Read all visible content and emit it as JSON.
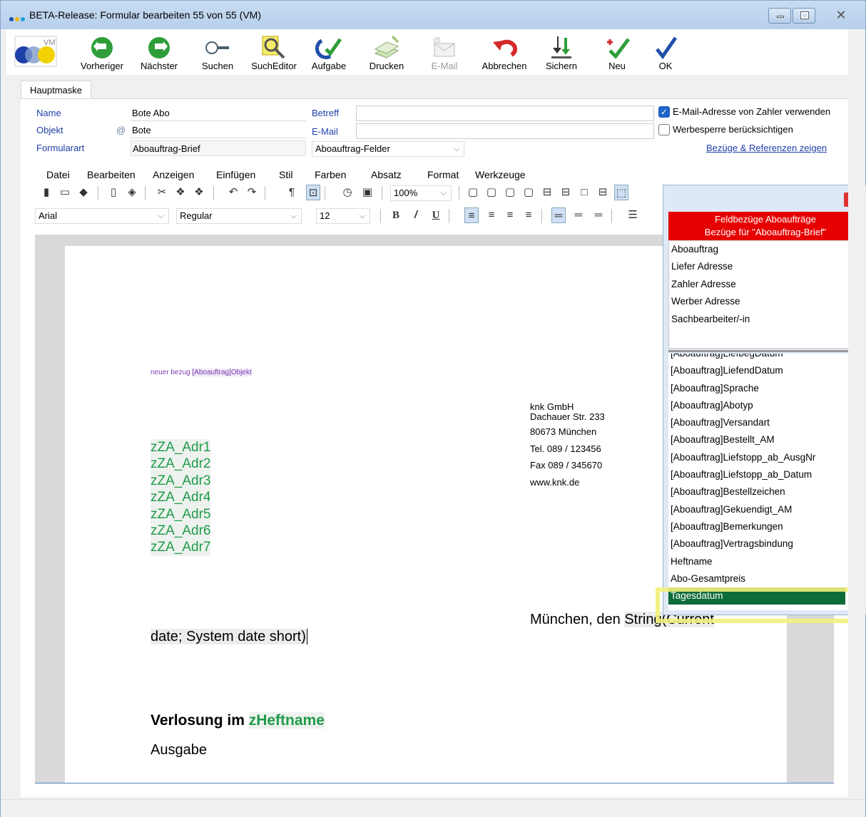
{
  "window": {
    "title": "BETA-Release: Formular  bearbeiten 55 von 55 (VM)"
  },
  "toolbar": {
    "prev": "Vorheriger",
    "next": "Nächster",
    "search": "Suchen",
    "search_editor": "SuchEditor",
    "task": "Aufgabe",
    "print": "Drucken",
    "email": "E-Mail",
    "cancel": "Abbrechen",
    "save": "Sichern",
    "new": "Neu",
    "ok": "OK",
    "logo": "VM"
  },
  "tabs": {
    "main": "Hauptmaske"
  },
  "form": {
    "name_label": "Name",
    "name_value": "Bote Abo",
    "object_label": "Objekt",
    "object_at": "@",
    "object_value": "Bote",
    "formtype_label": "Formularart",
    "formtype_value": "Aboauftrag-Brief",
    "subject_label": "Betreff",
    "subject_value": "",
    "email_label": "E-Mail",
    "email_value": "",
    "fields_select": "Aboauftrag-Felder",
    "use_payer_email": "E-Mail-Adresse von Zahler verwenden",
    "ad_block": "Werbesperre berücksichtigen",
    "refs_link": "Bezüge & Referenzen zeigen"
  },
  "editor": {
    "menu": [
      "Datei",
      "Bearbeiten",
      "Anzeigen",
      "Einfügen",
      "Stil",
      "Farben",
      "Absatz",
      "Format",
      "Werkzeuge"
    ],
    "zoom": "100%",
    "font": "Arial",
    "style": "Regular",
    "size": "12"
  },
  "document": {
    "new_ref_prefix": "neuer bezug ",
    "new_ref_tag": "[Aboauftrag]Objekt",
    "address_fields": [
      "zZA_Adr1",
      "zZA_Adr2",
      "zZA_Adr3",
      "zZA_Adr4",
      "zZA_Adr5",
      "zZA_Adr6",
      "zZA_Adr7"
    ],
    "company": [
      "knk GmbH",
      "Dachauer Str. 233",
      "80673 München",
      "Tel. 089 / 123456",
      "Fax 089 / 345670",
      "www.knk.de"
    ],
    "date_line_prefix": "München, den ",
    "date_line_field": "String(Current",
    "date_line_cont": "date; System date short)",
    "heading_prefix": "Verlosung im ",
    "heading_field": "zHeftname",
    "sub": "Ausgabe"
  },
  "popup": {
    "header_line1": "Feldbezüge Aboaufträge",
    "header_line2": "Bezüge für \"Aboauftrag-Brief\"",
    "close": "✕",
    "groups": [
      "Aboauftrag",
      "Liefer Adresse",
      "Zahler Adresse",
      "Werber Adresse",
      "Sachbearbeiter/-in"
    ],
    "partial": "[Aboauftrag]LiefbegDatum",
    "fields": [
      "[Aboauftrag]LiefendDatum",
      "[Aboauftrag]Sprache",
      "[Aboauftrag]Abotyp",
      "[Aboauftrag]Versandart",
      "[Aboauftrag]Bestellt_AM",
      "[Aboauftrag]Liefstopp_ab_AusgNr",
      "[Aboauftrag]Liefstopp_ab_Datum",
      "[Aboauftrag]Bestellzeichen",
      "[Aboauftrag]Gekuendigt_AM",
      "[Aboauftrag]Bemerkungen",
      "[Aboauftrag]Vertragsbindung",
      "Heftname",
      "Abo-Gesamtpreis",
      "Tagesdatum"
    ],
    "selected": "Tagesdatum"
  },
  "colors": {
    "accent": "#1f3fa8",
    "green": "#1e9b4a",
    "popup_red": "#e60000",
    "selected": "#0e6b3a"
  }
}
